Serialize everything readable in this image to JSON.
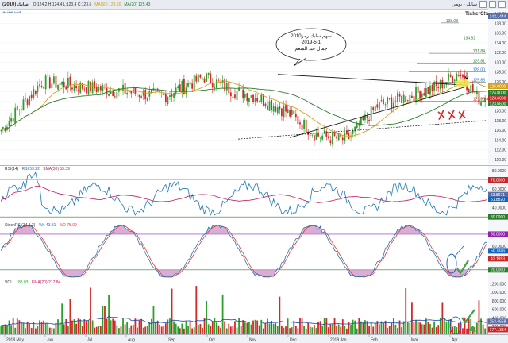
{
  "topbar": {
    "ticker": "سابك (2010)",
    "ohlc": "O:124.2  H:124.4  L:123.4  C:123.6",
    "ma1": "MA(50) 123.66",
    "ma2": "MA(20) 125.43",
    "right_title": "سابك - يومي"
  },
  "toolbar2": {
    "label": "ويب ستريم"
  },
  "logo": "TickerChart",
  "annotation": {
    "line1": "سهم سابك رمز2010",
    "line2": "2019-5-1",
    "line3": "جمال عبد المنعم"
  },
  "price_axis": {
    "labels": [
      "140.00",
      "138.00",
      "136.00",
      "134.00",
      "132.00",
      "130.00",
      "128.00",
      "126.00",
      "124.00",
      "122.00",
      "120.00",
      "118.00",
      "116.00",
      "114.00",
      "112.00",
      "110.00"
    ],
    "levels": [
      {
        "value": "138.08",
        "color": "#2e7d32"
      },
      {
        "value": "134.52",
        "color": "#2e7d32"
      },
      {
        "value": "131.84",
        "color": "#2e7d32"
      },
      {
        "value": "129.81",
        "color": "#2e7d32"
      },
      {
        "value": "128.00",
        "color": "#1565c0"
      },
      {
        "value": "125.86",
        "color": "#1565c0"
      },
      {
        "value": "121.96",
        "color": "#c62828"
      }
    ],
    "tags": [
      {
        "value": "142.1444",
        "color": "#5a6fa8"
      },
      {
        "value": "126.0000",
        "color": "#d4a017"
      },
      {
        "value": "124.8000",
        "color": "#2e7d32"
      },
      {
        "value": "123.6000",
        "color": "#c62828"
      },
      {
        "value": "123.6600",
        "color": "#2e7d32"
      }
    ]
  },
  "rsi": {
    "label": "RSI(14)",
    "value": "RSI 53.22",
    "sma_label": "SMA(30) 53.39",
    "axis": [
      "80.0000",
      "70.0000",
      "60.0000",
      "50.0000",
      "40.0000",
      "30.0000"
    ],
    "tags": [
      {
        "value": "70.0000",
        "color": "#c62828"
      },
      {
        "value": "53.8671",
        "color": "#5a6fa8"
      },
      {
        "value": "51.8820",
        "color": "#1565c0"
      },
      {
        "value": "30.0000",
        "color": "#2e7d32"
      }
    ]
  },
  "stoch": {
    "label": "StochRSI(14,3,3)",
    "value": "%K 43.81",
    "d_label": "%D 75.09",
    "axis": [
      "80.0000",
      "60.0000",
      "40.0000",
      "20.0000"
    ],
    "tags": [
      {
        "value": "80.0000",
        "color": "#8e24aa"
      },
      {
        "value": "50.7346",
        "color": "#1565c0"
      },
      {
        "value": "42.1993",
        "color": "#c62828"
      },
      {
        "value": "20.0000",
        "color": "#2e7d32"
      }
    ]
  },
  "vol": {
    "label": "VOL",
    "value": "183.03",
    "ma_label": "EMA(20) 217.84",
    "axis": [
      "1200.000",
      "1000.000",
      "800.000",
      "600.000",
      "400.000",
      "200.000"
    ],
    "tags": [
      {
        "value": "253.4658",
        "color": "#5a6fa8"
      },
      {
        "value": "177.1334",
        "color": "#c62828"
      }
    ]
  },
  "date_axis": {
    "labels": [
      "2018 May",
      "Jun",
      "Jul",
      "Aug",
      "Sep",
      "Oct",
      "Nov",
      "Dec",
      "2019 Jan",
      "Feb",
      "Mar",
      "Apr"
    ]
  },
  "colors": {
    "up": "#2ca02c",
    "down": "#d62728",
    "ma_fast": "#d4a017",
    "ma_slow": "#2e7d32",
    "rsi": "#1f77b4",
    "rsi_sma": "#c2185b",
    "stoch_k": "#1f77b4",
    "stoch_d": "#e53935",
    "stoch_fill": "#c98ac2"
  }
}
